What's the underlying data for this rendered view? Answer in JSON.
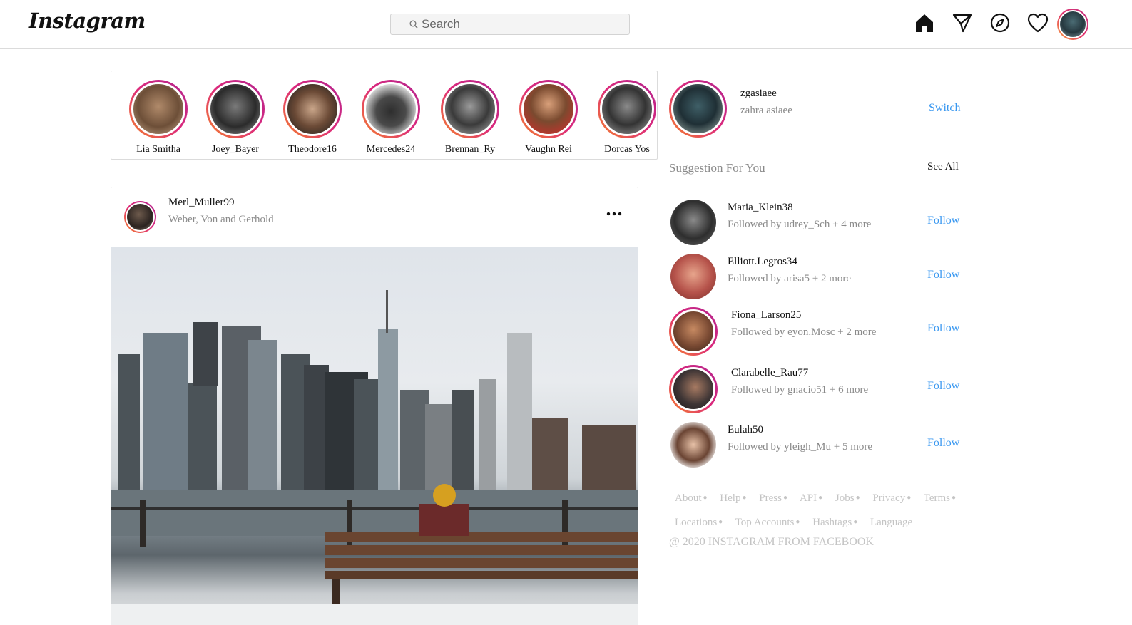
{
  "header": {
    "logo": "Instagram",
    "search_placeholder": "Search",
    "icons": [
      "home-icon",
      "direct-message-icon",
      "explore-icon",
      "activity-heart-icon",
      "profile-avatar"
    ]
  },
  "stories": [
    {
      "name": "Lia Smitha",
      "color": "#8a6a50"
    },
    {
      "name": "Joey_Bayer",
      "color": "#3b3b3b"
    },
    {
      "name": "Theodore16",
      "color": "#7c6656"
    },
    {
      "name": "Mercedes24",
      "color": "#c9c9c9"
    },
    {
      "name": "Brennan_Ry",
      "color": "#555555"
    },
    {
      "name": "Vaughn Rei",
      "color": "#9b5a3a"
    },
    {
      "name": "Dorcas Yos",
      "color": "#5a5a5a"
    }
  ],
  "post": {
    "username": "Merl_Muller99",
    "subtitle": "Weber, Von and Gerhold",
    "more_icon": "more-options-icon"
  },
  "sidebar": {
    "me": {
      "username": "zgasiaee",
      "name": "zahra asiaee",
      "switch_label": "Switch"
    },
    "suggestions_title": "Suggestion For You",
    "see_all_label": "See All",
    "suggestions": [
      {
        "username": "Maria_Klein38",
        "followed_by": "Followed by udrey_Sch + 4 more",
        "follow_label": "Follow",
        "color": "#2e2e2e"
      },
      {
        "username": "Elliott.Legros34",
        "followed_by": "Followed by arisa5 + 2 more",
        "follow_label": "Follow",
        "color": "#b5524a"
      },
      {
        "username": "Fiona_Larson25",
        "followed_by": "Followed by eyon.Mosc + 2 more",
        "follow_label": "Follow",
        "color": "#7a4a33"
      },
      {
        "username": "Clarabelle_Rau77",
        "followed_by": "Followed by gnacio51 + 6 more",
        "follow_label": "Follow",
        "color": "#3e3535"
      },
      {
        "username": "Eulah50",
        "followed_by": "Followed by yleigh_Mu + 5 more",
        "follow_label": "Follow",
        "color": "#6a4433"
      }
    ],
    "footer_links": [
      "About",
      "Help",
      "Press",
      "API",
      "Jobs",
      "Privacy",
      "Terms",
      "Locations",
      "Top Accounts",
      "Hashtags",
      "Language"
    ],
    "copyright": "@ 2020 INSTAGRAM FROM FACEBOOK"
  }
}
